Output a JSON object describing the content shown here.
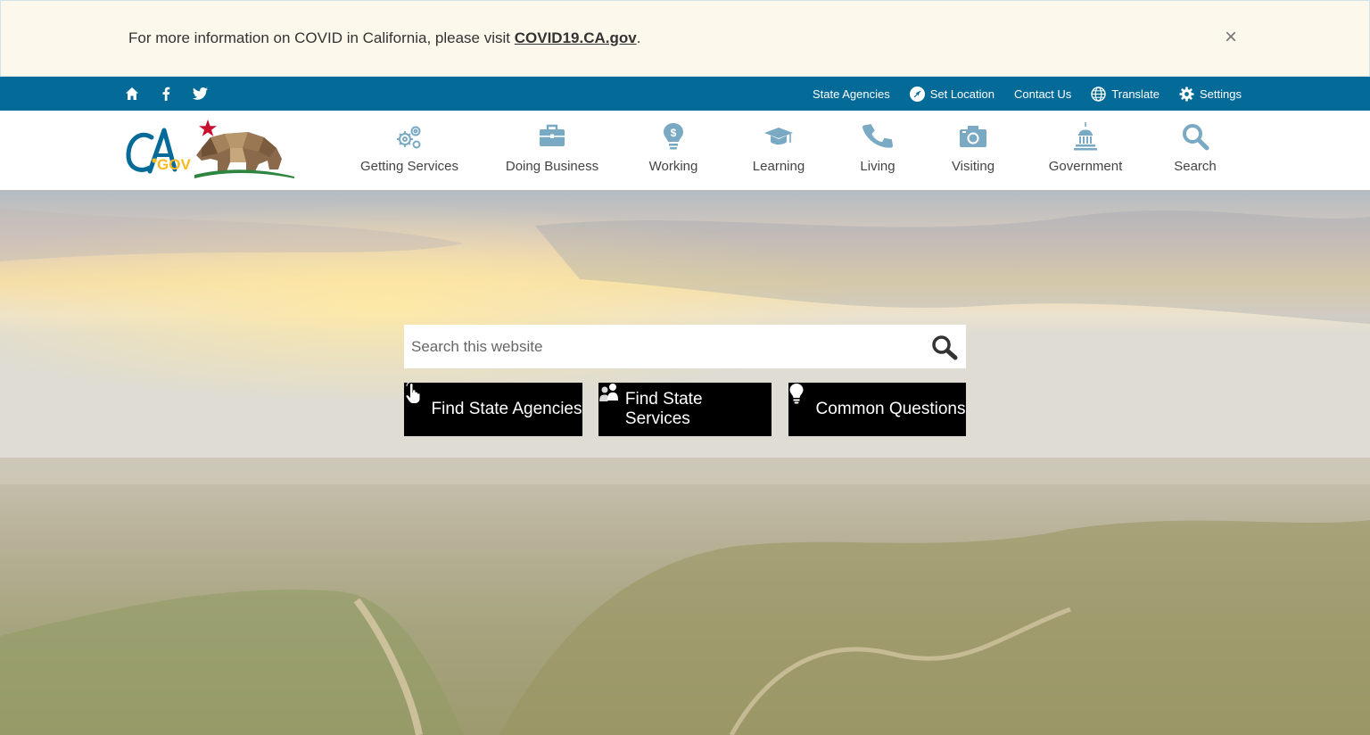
{
  "alert": {
    "text": "For more information on COVID in California, please visit ",
    "link": "COVID19.CA.gov",
    "suffix": ".",
    "close": "×"
  },
  "utility": {
    "icons": [
      "home-icon",
      "facebook-icon",
      "twitter-icon"
    ],
    "links": [
      {
        "label": "State Agencies",
        "icon": ""
      },
      {
        "label": "Set Location",
        "icon": "location-icon"
      },
      {
        "label": "Contact Us",
        "icon": ""
      },
      {
        "label": "Translate",
        "icon": "globe-icon"
      },
      {
        "label": "Settings",
        "icon": "gear-icon"
      }
    ]
  },
  "nav": {
    "items": [
      {
        "label": "Getting Services",
        "icon": "gears-icon"
      },
      {
        "label": "Doing Business",
        "icon": "briefcase-icon"
      },
      {
        "label": "Working",
        "icon": "lightbulb-dollar-icon"
      },
      {
        "label": "Learning",
        "icon": "graduation-cap-icon"
      },
      {
        "label": "Living",
        "icon": "phone-icon"
      },
      {
        "label": "Visiting",
        "icon": "camera-icon"
      },
      {
        "label": "Government",
        "icon": "capitol-icon"
      },
      {
        "label": "Search",
        "icon": "search-icon"
      }
    ]
  },
  "hero": {
    "search_placeholder": "Search this website",
    "buttons": [
      {
        "label": "Find State Agencies",
        "icon": "pointer-hand-icon"
      },
      {
        "label": "Find State Services",
        "icon": "people-icon"
      },
      {
        "label": "Common Questions",
        "icon": "lightbulb-icon"
      }
    ]
  },
  "colors": {
    "utility_bar": "#046b99",
    "alert_bg": "#fdf8ec",
    "nav_icon": "#7aa9c4",
    "button_bg": "#000000"
  }
}
